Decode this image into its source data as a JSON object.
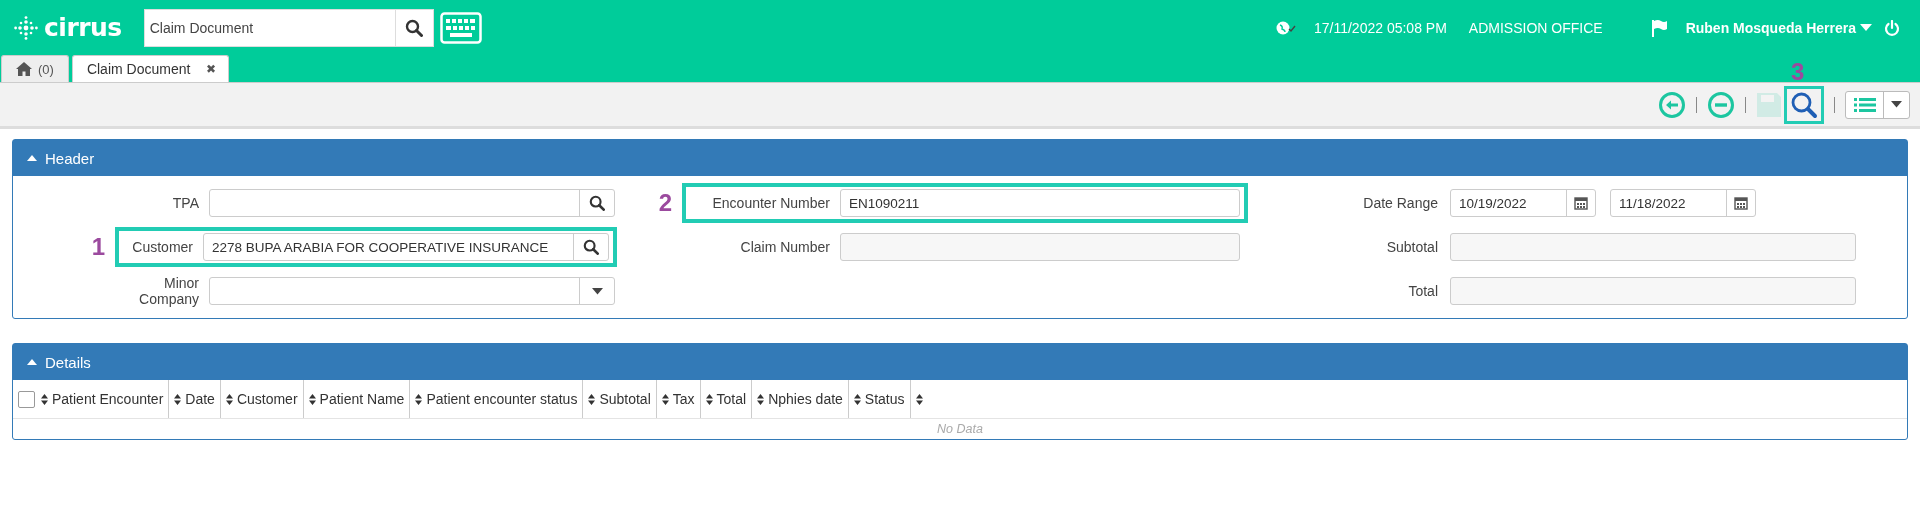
{
  "topbar": {
    "logo": "cirrus",
    "search": {
      "value": "Claim Document"
    },
    "datetime": "17/11/2022 05:08 PM",
    "office": "ADMISSION OFFICE",
    "user": "Ruben Mosqueda Herrera"
  },
  "tabs": [
    {
      "kind": "home",
      "label": "(0)",
      "selected": false
    },
    {
      "kind": "document",
      "label": "Claim Document",
      "close": "✖",
      "selected": true
    }
  ],
  "toolbar": [
    {
      "kind": "back",
      "disabled": false
    },
    {
      "kind": "remove",
      "disabled": false
    },
    {
      "kind": "save",
      "disabled": true
    },
    {
      "kind": "search",
      "disabled": false,
      "annotation": "3"
    },
    {
      "kind": "list",
      "disabled": false
    }
  ],
  "header": {
    "title": "Header",
    "expanded": true,
    "columns": [
      [
        {
          "kind": "lookup",
          "label": "TPA"
        },
        {
          "kind": "lookup",
          "label": "Customer",
          "value": "2278 BUPA ARABIA FOR COOPERATIVE INSURANCE",
          "annotation": "1"
        },
        {
          "kind": "select",
          "label": "Minor Company"
        }
      ],
      [
        {
          "kind": "text",
          "label": "Encounter Number",
          "value": "EN1090211",
          "annotation": "2"
        },
        {
          "kind": "readonly",
          "label": "Claim Number"
        }
      ],
      [
        {
          "kind": "daterange",
          "label": "Date Range",
          "from": "10/19/2022",
          "to": "11/18/2022"
        },
        {
          "kind": "readonly",
          "label": "Subtotal"
        },
        {
          "kind": "readonly",
          "label": "Total"
        }
      ]
    ]
  },
  "details": {
    "title": "Details",
    "expanded": true,
    "select_all_checked": false,
    "columns": [
      "Patient Encounter",
      "Date",
      "Customer",
      "Patient Name",
      "Patient encounter status",
      "Subtotal",
      "Tax",
      "Total",
      "Nphies date",
      "Status"
    ],
    "empty_text": "No Data"
  }
}
